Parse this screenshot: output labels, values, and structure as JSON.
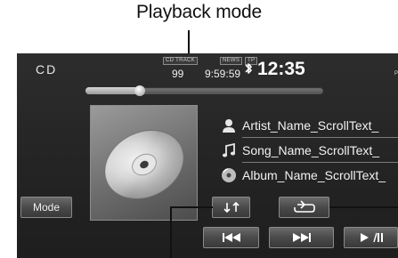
{
  "annotation": {
    "label": "Playback mode"
  },
  "header": {
    "source": "CD",
    "badges": {
      "track": "CD TRACK",
      "news": "NEWS",
      "tp": "TP"
    },
    "track_number": "99",
    "elapsed_time": "9:59:59",
    "clock": "12:35",
    "clock_suffix": "PM"
  },
  "playback": {
    "progress_fraction": 0.23
  },
  "track_info": {
    "artist": "Artist_Name_ScrollText_",
    "song": "Song_Name_ScrollText_",
    "album": "Album_Name_ScrollText_"
  },
  "controls": {
    "mode_label": "Mode"
  },
  "icons": [
    "bluetooth-icon",
    "disc-icon",
    "artist-icon",
    "music-note-icon",
    "album-icon",
    "random-icon",
    "repeat-icon",
    "previous-icon",
    "next-icon",
    "play-pause-icon"
  ],
  "colors": {
    "screen_bg": "#262626",
    "text": "#f0f0f0",
    "button": "#4a4a4a"
  }
}
